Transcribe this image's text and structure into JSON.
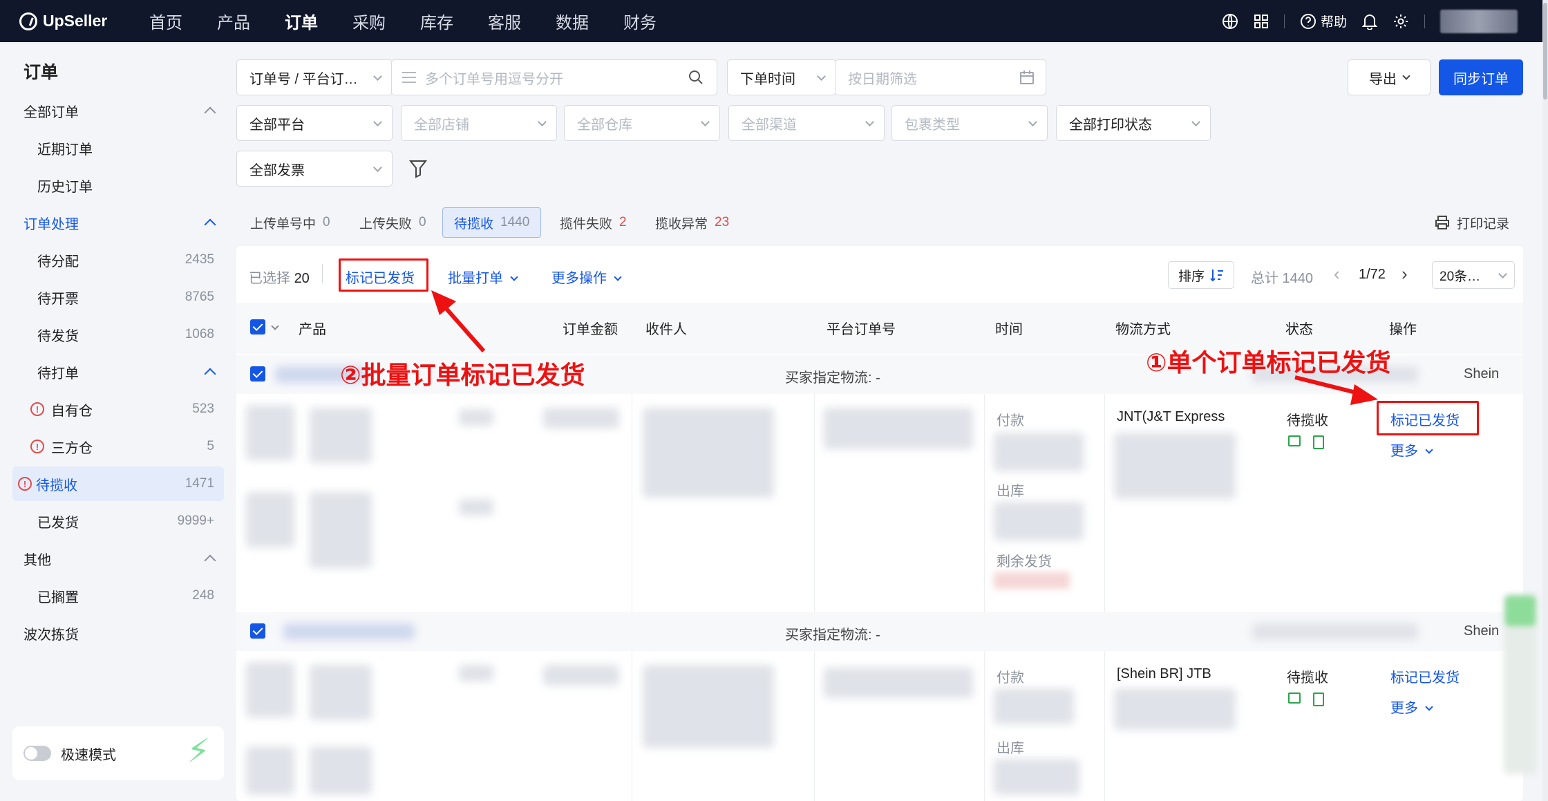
{
  "app": {
    "logo": "UpSeller"
  },
  "nav": [
    "首页",
    "产品",
    "订单",
    "采购",
    "库存",
    "客服",
    "数据",
    "财务"
  ],
  "nav_active": "订单",
  "topright": {
    "help": "帮助"
  },
  "sidebar": {
    "title": "订单",
    "all_orders": "全部订单",
    "recent": "近期订单",
    "history": "历史订单",
    "processing": "订单处理",
    "items": [
      {
        "label": "待分配",
        "count": "2435"
      },
      {
        "label": "待开票",
        "count": "8765"
      },
      {
        "label": "待发货",
        "count": "1068"
      }
    ],
    "to_print": "待打单",
    "own_wh": {
      "label": "自有仓",
      "count": "523"
    },
    "third_wh": {
      "label": "三方仓",
      "count": "5"
    },
    "pickup": {
      "label": "待揽收",
      "count": "1471"
    },
    "shipped": {
      "label": "已发货",
      "count": "9999+"
    },
    "other": "其他",
    "shelved": {
      "label": "已搁置",
      "count": "248"
    },
    "wave": "波次拣货",
    "speed_mode": "极速模式"
  },
  "filters": {
    "order_type": "订单号 / 平台订…",
    "order_placeholder": "多个订单号用逗号分开",
    "time_type": "下单时间",
    "date_placeholder": "按日期筛选",
    "export": "导出",
    "sync": "同步订单",
    "platform": "全部平台",
    "store": "全部店铺",
    "warehouse": "全部仓库",
    "channel": "全部渠道",
    "package": "包裹类型",
    "print_status": "全部打印状态",
    "invoice": "全部发票"
  },
  "status_tabs": [
    {
      "label": "上传单号中",
      "count": "0"
    },
    {
      "label": "上传失败",
      "count": "0"
    },
    {
      "label": "待揽收",
      "count": "1440"
    },
    {
      "label": "揽件失败",
      "count": "2"
    },
    {
      "label": "揽收异常",
      "count": "23"
    }
  ],
  "print_log": "打印记录",
  "toolbar": {
    "selected_label": "已选择",
    "selected_count": "20",
    "mark_shipped": "标记已发货",
    "batch_print": "批量打单",
    "more_ops": "更多操作",
    "sort": "排序",
    "total": "总计 1440",
    "page": "1/72",
    "page_size": "20条…"
  },
  "columns": [
    "产品",
    "订单金额",
    "收件人",
    "平台订单号",
    "时间",
    "物流方式",
    "状态",
    "操作"
  ],
  "orders": [
    {
      "buyer_logistics": "买家指定物流: -",
      "platform": "Shein",
      "pay": "付款",
      "out": "出库",
      "remain": "剩余发货",
      "logistics": "JNT(J&T Express",
      "status": "待揽收",
      "action": "标记已发货",
      "more": "更多"
    },
    {
      "buyer_logistics": "买家指定物流: -",
      "platform": "Shein",
      "pay": "付款",
      "out": "出库",
      "logistics": "[Shein BR] JTB",
      "status": "待揽收",
      "action": "标记已发货",
      "more": "更多"
    }
  ],
  "annotations": {
    "batch": "②批量订单标记已发货",
    "single": "①单个订单标记已发货"
  },
  "colors": {
    "accent": "#1456e6",
    "annotation": "#e11111",
    "nav_bg": "#10172a"
  }
}
